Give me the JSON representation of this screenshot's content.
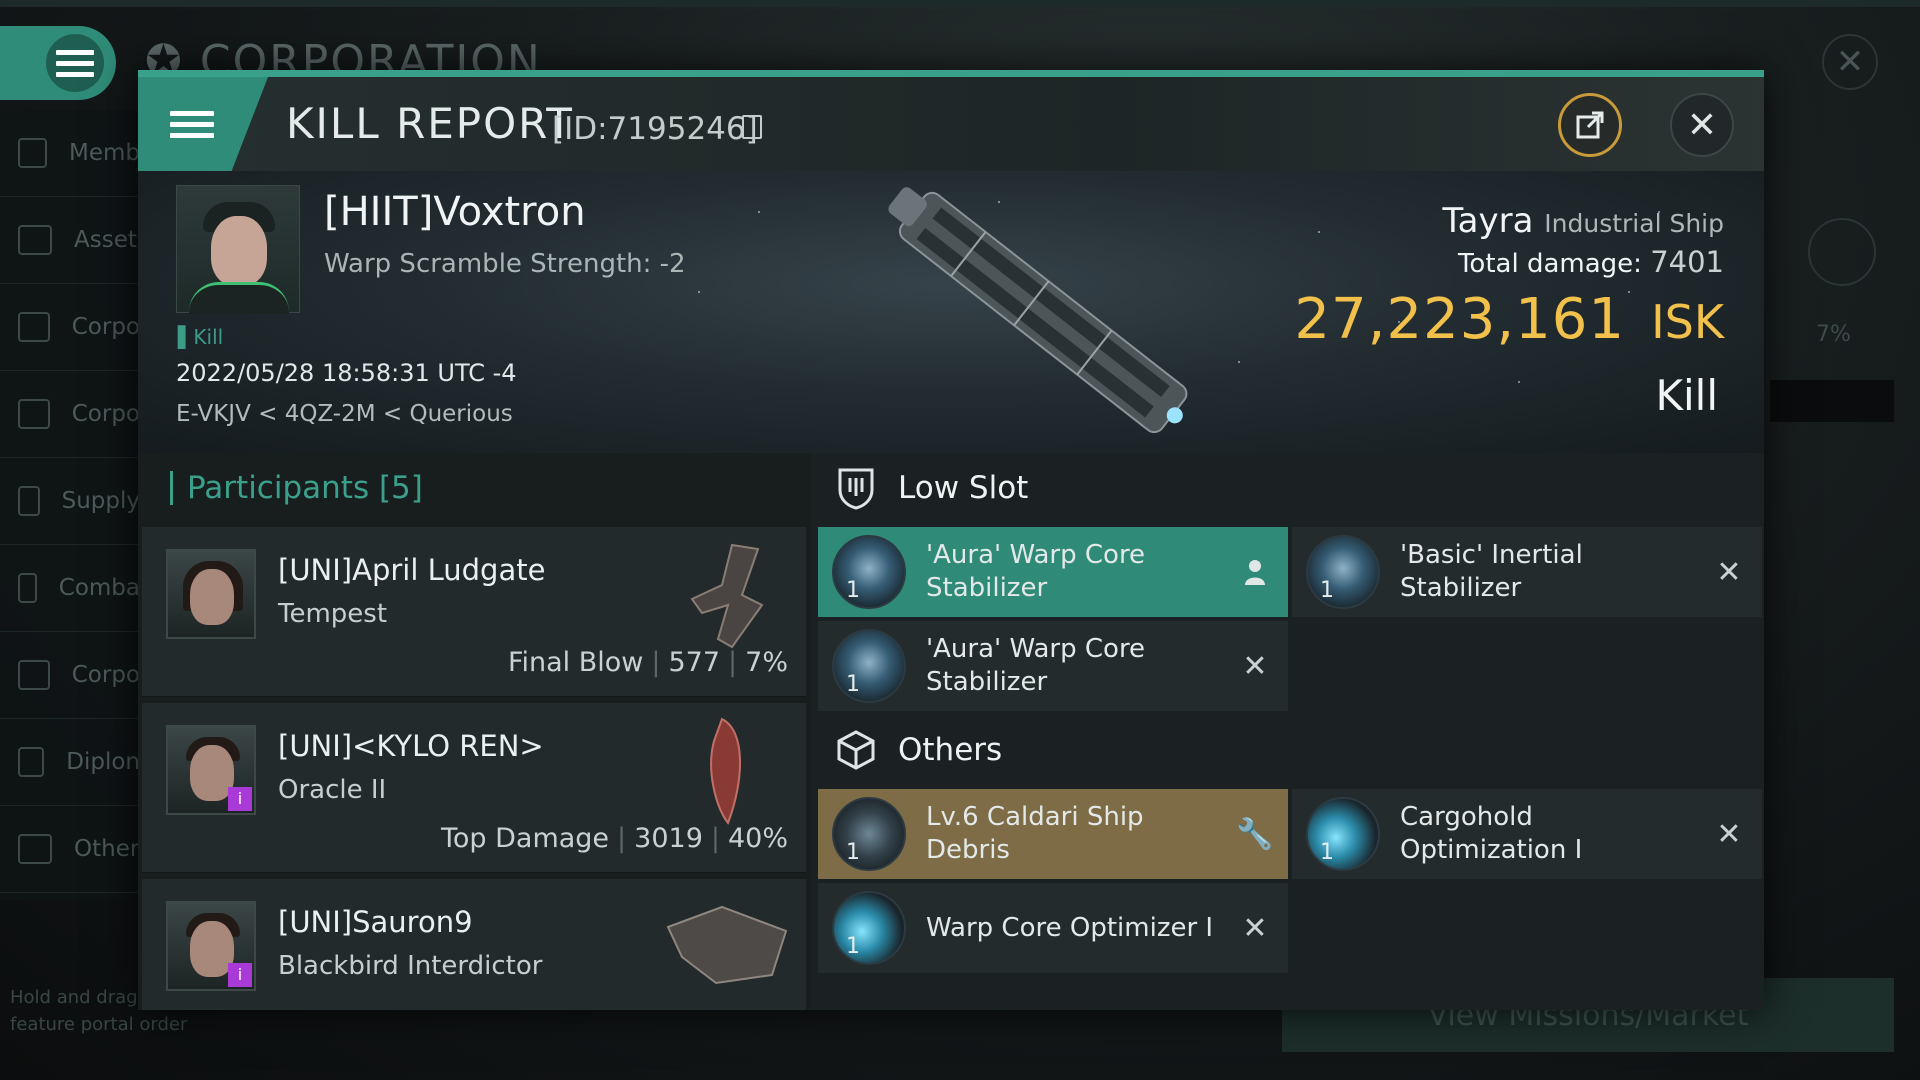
{
  "background": {
    "title": "CORPORATION",
    "sidebar": [
      {
        "label": "Memb",
        "icon": "members-icon"
      },
      {
        "label": "Asset",
        "icon": "assets-icon"
      },
      {
        "label": "Corpo",
        "icon": "bar-chart-icon"
      },
      {
        "label": "Corpo",
        "icon": "pie-chart-icon"
      },
      {
        "label": "Supply",
        "icon": "supply-icon"
      },
      {
        "label": "Comba",
        "icon": "combat-icon"
      },
      {
        "label": "Corpo",
        "icon": "document-icon"
      },
      {
        "label": "Diplon",
        "icon": "diplomacy-icon"
      },
      {
        "label": "Other",
        "icon": "star-icon"
      }
    ],
    "hint_line1": "Hold and drag",
    "hint_line2": "feature portal order",
    "right_pct": "7%",
    "bottom_button": "View Missions/Market"
  },
  "header": {
    "title": "KILL REPORT",
    "id_label": "[ID:7195246]"
  },
  "victim": {
    "name": "[HIIT]Voxtron",
    "warp_scramble": "Warp Scramble Strength: -2",
    "tag": "Kill",
    "datetime": "2022/05/28 18:58:31 UTC -4",
    "location": "E-VKJV < 4QZ-2M < Querious",
    "ship_name": "Tayra",
    "ship_class": "Industrial Ship",
    "total_damage_label": "Total damage:",
    "total_damage": "7401",
    "isk_value": "27,223,161",
    "isk_unit": "ISK",
    "result": "Kill"
  },
  "participants": {
    "header": "Participants [5]",
    "items": [
      {
        "name": "[UNI]April Ludgate",
        "ship": "Tempest",
        "label": "Final Blow",
        "damage": "577",
        "percent": "7%"
      },
      {
        "name": "[UNI]<KYLO REN>",
        "ship": "Oracle II",
        "label": "Top Damage",
        "damage": "3019",
        "percent": "40%"
      },
      {
        "name": "[UNI]Sauron9",
        "ship": "Blackbird Interdictor",
        "label": "",
        "damage": "",
        "percent": ""
      }
    ]
  },
  "fittings": {
    "low_slot_title": "Low Slot",
    "others_title": "Others",
    "low_slot": [
      {
        "name": "'Aura' Warp Core Stabilizer",
        "qty": "1"
      },
      {
        "name": "'Basic' Inertial Stabilizer",
        "qty": "1"
      },
      {
        "name": "'Aura' Warp Core Stabilizer",
        "qty": "1"
      }
    ],
    "others": [
      {
        "name": "Lv.6 Caldari Ship Debris",
        "qty": "1"
      },
      {
        "name": "Cargohold Optimization I",
        "qty": "1"
      },
      {
        "name": "Warp Core Optimizer I",
        "qty": "1"
      }
    ]
  }
}
